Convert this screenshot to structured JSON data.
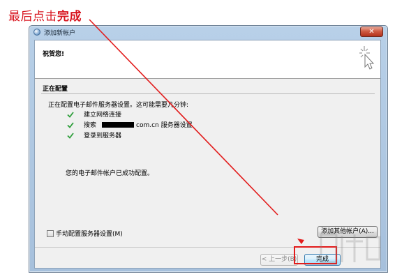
{
  "caption": {
    "prefix": "最后点击",
    "emphasis": "完成"
  },
  "window": {
    "title": "添加新帐户",
    "close_label": "✕"
  },
  "header": {
    "title": "祝贺您!"
  },
  "section": {
    "title": "正在配置"
  },
  "status": {
    "text": "正在配置电子邮件服务器设置。这可能需要几分钟:",
    "steps": [
      {
        "label": "建立网络连接"
      },
      {
        "prefix": "搜索",
        "suffix": "com.cn 服务器设置"
      },
      {
        "label": "登录到服务器"
      }
    ]
  },
  "success_text": "您的电子邮件帐户已成功配置。",
  "manual_config": {
    "label": "手动配置服务器设置(M)",
    "checked": false
  },
  "buttons": {
    "add_other": "添加其他帐户(A)...",
    "prev": "< 上一步(B)",
    "finish": "完成"
  },
  "colors": {
    "annotation": "#e21b1b",
    "check": "#2e9e3b"
  },
  "icons": {
    "app": "outlook-globe-icon",
    "header": "sparkle-cursor-icon",
    "step": "check-icon"
  }
}
